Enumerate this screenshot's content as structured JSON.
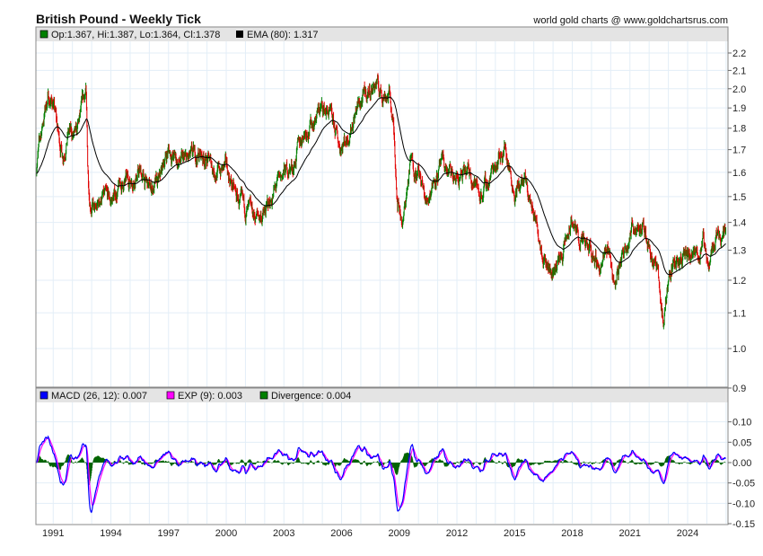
{
  "title": "British Pound - Weekly Tick",
  "site": "world gold charts @ www.goldchartsrus.com",
  "price_legend": {
    "ohlc": "Op:1.367, Hi:1.387, Lo:1.364, Cl:1.378",
    "ema": "EMA (80): 1.317"
  },
  "macd_legend": {
    "macd": "MACD (26, 12): 0.007",
    "exp": "EXP (9): 0.003",
    "divergence": "Divergence: 0.004"
  },
  "colors": {
    "up": "#008000",
    "down": "#e00000",
    "ema": "#000000",
    "macd": "#0000ff",
    "exp": "#ff00ff",
    "divergence": "#006400",
    "grid": "#e3eef7",
    "legend_bg": "#e4e4e4"
  },
  "chart_data": [
    {
      "type": "line",
      "title": "British Pound - Weekly Tick",
      "subtype": "candlestick",
      "xlim": [
        1990.1,
        2026.1
      ],
      "ylim": [
        0.9,
        2.2
      ],
      "yscale": "log",
      "grid": true,
      "y_ticks": [
        "2.2",
        "2.1",
        "2.0",
        "1.9",
        "1.8",
        "1.7",
        "1.6",
        "1.5",
        "1.4",
        "1.3",
        "1.2",
        "1.1",
        "1.0",
        "0.9"
      ],
      "x_ticks": [
        "1991",
        "1994",
        "1997",
        "2000",
        "2003",
        "2006",
        "2009",
        "2012",
        "2015",
        "2018",
        "2021",
        "2024"
      ],
      "ema_period": 80,
      "close_path": [
        [
          1990.1,
          1.62
        ],
        [
          1990.5,
          1.85
        ],
        [
          1990.7,
          1.95
        ],
        [
          1991.0,
          1.93
        ],
        [
          1991.3,
          1.75
        ],
        [
          1991.5,
          1.68
        ],
        [
          1991.8,
          1.78
        ],
        [
          1992.2,
          1.75
        ],
        [
          1992.6,
          1.95
        ],
        [
          1992.7,
          1.99
        ],
        [
          1992.8,
          1.6
        ],
        [
          1992.9,
          1.5
        ],
        [
          1993.2,
          1.43
        ],
        [
          1993.5,
          1.5
        ],
        [
          1994.0,
          1.48
        ],
        [
          1994.5,
          1.54
        ],
        [
          1995.0,
          1.57
        ],
        [
          1995.5,
          1.6
        ],
        [
          1996.0,
          1.53
        ],
        [
          1996.5,
          1.55
        ],
        [
          1996.8,
          1.66
        ],
        [
          1997.0,
          1.7
        ],
        [
          1997.5,
          1.64
        ],
        [
          1998.0,
          1.65
        ],
        [
          1998.6,
          1.68
        ],
        [
          1999.0,
          1.66
        ],
        [
          1999.5,
          1.6
        ],
        [
          2000.0,
          1.62
        ],
        [
          2000.5,
          1.5
        ],
        [
          2000.9,
          1.45
        ],
        [
          2001.5,
          1.42
        ],
        [
          2002.0,
          1.43
        ],
        [
          2002.5,
          1.52
        ],
        [
          2003.0,
          1.6
        ],
        [
          2003.5,
          1.63
        ],
        [
          2004.0,
          1.78
        ],
        [
          2004.5,
          1.83
        ],
        [
          2004.9,
          1.9
        ],
        [
          2005.3,
          1.88
        ],
        [
          2005.9,
          1.72
        ],
        [
          2006.3,
          1.76
        ],
        [
          2006.8,
          1.9
        ],
        [
          2007.3,
          1.97
        ],
        [
          2007.8,
          2.03
        ],
        [
          2008.0,
          1.98
        ],
        [
          2008.5,
          1.97
        ],
        [
          2008.7,
          1.8
        ],
        [
          2008.9,
          1.5
        ],
        [
          2009.2,
          1.4
        ],
        [
          2009.6,
          1.65
        ],
        [
          2010.0,
          1.6
        ],
        [
          2010.4,
          1.47
        ],
        [
          2010.8,
          1.58
        ],
        [
          2011.3,
          1.63
        ],
        [
          2011.8,
          1.57
        ],
        [
          2012.3,
          1.58
        ],
        [
          2012.7,
          1.6
        ],
        [
          2013.2,
          1.51
        ],
        [
          2013.6,
          1.55
        ],
        [
          2014.0,
          1.65
        ],
        [
          2014.5,
          1.71
        ],
        [
          2015.0,
          1.52
        ],
        [
          2015.5,
          1.56
        ],
        [
          2016.0,
          1.43
        ],
        [
          2016.5,
          1.3
        ],
        [
          2016.9,
          1.22
        ],
        [
          2017.5,
          1.29
        ],
        [
          2018.0,
          1.4
        ],
        [
          2018.5,
          1.32
        ],
        [
          2019.0,
          1.29
        ],
        [
          2019.5,
          1.24
        ],
        [
          2019.9,
          1.31
        ],
        [
          2020.2,
          1.18
        ],
        [
          2020.5,
          1.26
        ],
        [
          2021.0,
          1.37
        ],
        [
          2021.4,
          1.4
        ],
        [
          2021.9,
          1.34
        ],
        [
          2022.4,
          1.24
        ],
        [
          2022.75,
          1.07
        ],
        [
          2023.0,
          1.21
        ],
        [
          2023.5,
          1.28
        ],
        [
          2024.0,
          1.27
        ],
        [
          2024.5,
          1.28
        ],
        [
          2024.8,
          1.33
        ],
        [
          2025.0,
          1.24
        ],
        [
          2025.5,
          1.36
        ],
        [
          2026.0,
          1.378
        ]
      ],
      "last": {
        "open": 1.367,
        "high": 1.387,
        "low": 1.364,
        "close": 1.378,
        "ema": 1.317
      }
    },
    {
      "type": "line",
      "title": "MACD",
      "ylim": [
        -0.15,
        0.15
      ],
      "y_ticks": [
        "0.10",
        "0.05",
        "0.00",
        "-0.05",
        "-0.10",
        "-0.15"
      ],
      "series": [
        {
          "name": "MACD (26, 12)",
          "last": 0.007
        },
        {
          "name": "EXP (9)",
          "last": 0.003
        },
        {
          "name": "Divergence",
          "last": 0.004
        }
      ]
    }
  ]
}
